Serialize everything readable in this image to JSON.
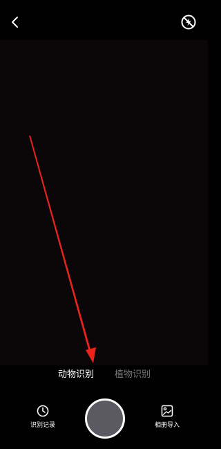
{
  "top_bar": {
    "back_icon": "chevron-left-icon",
    "flash_icon": "flash-off-icon"
  },
  "annotation": {
    "color": "#e8231c"
  },
  "mode_tabs": {
    "items": [
      {
        "label": "动物识别",
        "active": true
      },
      {
        "label": "植物识别",
        "active": false
      }
    ]
  },
  "bottom_bar": {
    "history_label": "识别记录",
    "history_icon": "clock-icon",
    "album_label": "相册导入",
    "album_icon": "image-icon",
    "shutter_color": "#5b5a63"
  }
}
